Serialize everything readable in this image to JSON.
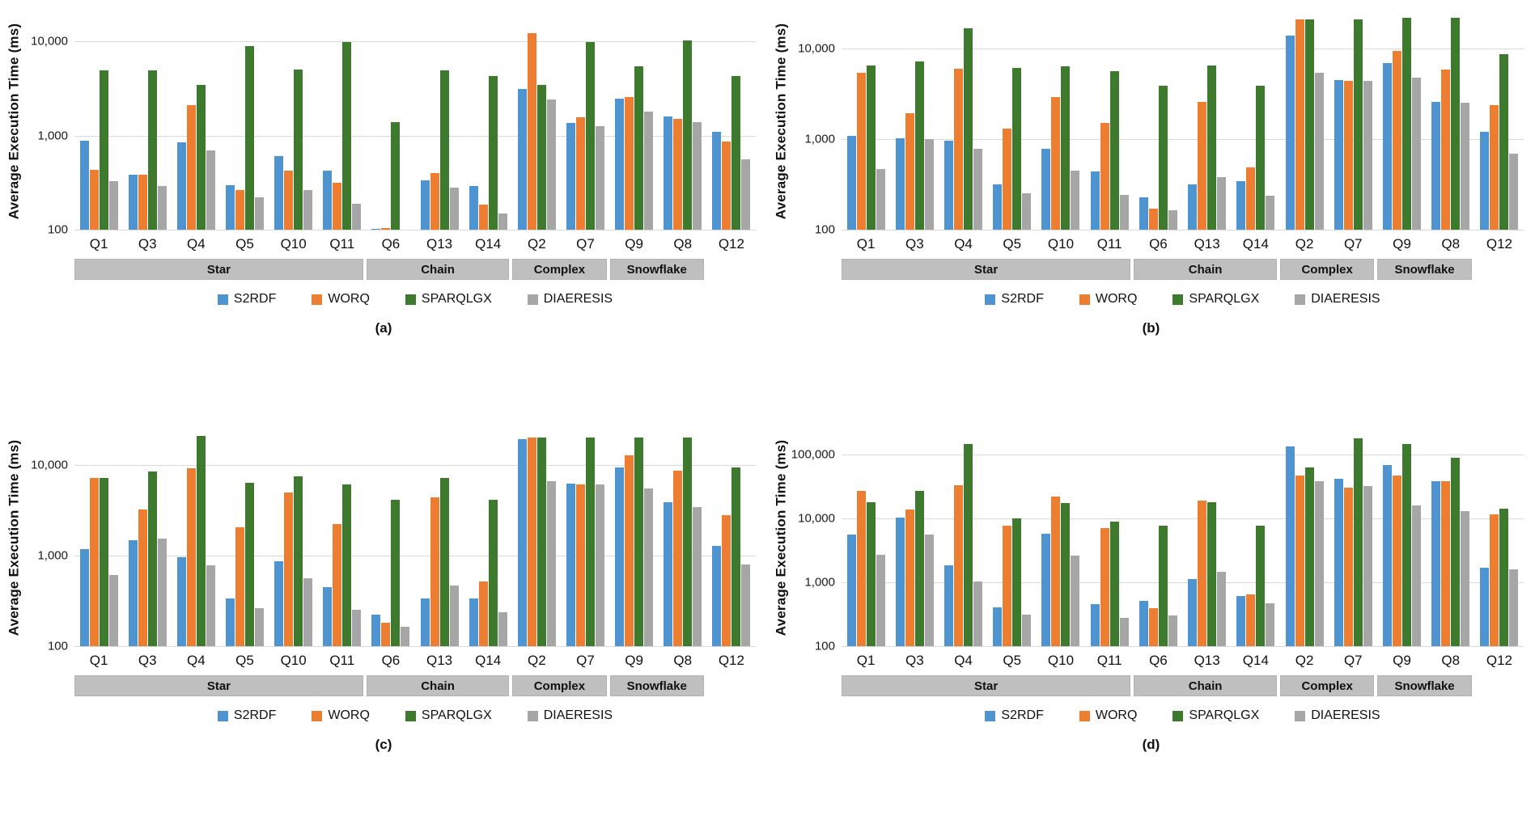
{
  "figure": {
    "panels": [
      "a",
      "b",
      "c",
      "d"
    ],
    "series_names": [
      "S2RDF",
      "WORQ",
      "SPARQLGX",
      "DIAERESIS"
    ],
    "series_colors": {
      "S2RDF": "#4e94d1",
      "WORQ": "#ed7d31",
      "SPARQLGX": "#3d7a2e",
      "DIAERESIS": "#a6a6a6"
    },
    "band_color": "#bfbfbf",
    "gridline_color": "#d9d9d9"
  },
  "legend": {
    "items": [
      {
        "label": "S2RDF",
        "swatch": "legend-swatch-blue"
      },
      {
        "label": "WORQ",
        "swatch": "legend-swatch-orange"
      },
      {
        "label": "SPARQLGX",
        "swatch": "legend-swatch-green"
      },
      {
        "label": "DIAERESIS",
        "swatch": "legend-swatch-gray"
      }
    ]
  },
  "bands": [
    {
      "label": "Star",
      "span": 6
    },
    {
      "label": "Chain",
      "span": 3
    },
    {
      "label": "Complex",
      "span": 2
    },
    {
      "label": "Snowflake",
      "span": 2
    }
  ],
  "captions": {
    "a": "(a)",
    "b": "(b)",
    "c": "(c)",
    "d": "(d)"
  },
  "chart_data": [
    {
      "panel": "a",
      "type": "bar",
      "title": "",
      "xlabel": "",
      "ylabel": "Average Execution Time (ms)",
      "yscale": "log",
      "ylim": [
        100,
        20000
      ],
      "yticks": [
        100,
        1000,
        10000
      ],
      "ytick_labels": [
        "100",
        "1,000",
        "10,000"
      ],
      "grid": true,
      "legend_position": "bottom",
      "categories": [
        "Q1",
        "Q3",
        "Q4",
        "Q5",
        "Q10",
        "Q11",
        "Q6",
        "Q13",
        "Q14",
        "Q2",
        "Q7",
        "Q9",
        "Q8",
        "Q12"
      ],
      "groups": [
        "Star",
        "Star",
        "Star",
        "Star",
        "Star",
        "Star",
        "Chain",
        "Chain",
        "Chain",
        "Complex",
        "Complex",
        "Snowflake",
        "Snowflake",
        "Snowflake"
      ],
      "series": [
        {
          "name": "S2RDF",
          "values": [
            880,
            385,
            840,
            295,
            600,
            425,
            103,
            335,
            290,
            3100,
            1350,
            2450,
            1600,
            1090
          ]
        },
        {
          "name": "WORQ",
          "values": [
            430,
            380,
            2100,
            265,
            425,
            315,
            105,
            400,
            185,
            12200,
            1550,
            2560,
            1500,
            870
          ]
        },
        {
          "name": "SPARQLGX",
          "values": [
            4900,
            4950,
            3450,
            8900,
            5000,
            9900,
            1400,
            4900,
            4250,
            3450,
            9900,
            5400,
            10300,
            4300
          ]
        },
        {
          "name": "DIAERESIS",
          "values": [
            330,
            290,
            690,
            220,
            265,
            190,
            null,
            280,
            150,
            2400,
            1250,
            1780,
            1400,
            560
          ]
        }
      ]
    },
    {
      "panel": "b",
      "type": "bar",
      "title": "",
      "xlabel": "",
      "ylabel": "Average Execution Time (ms)",
      "yscale": "log",
      "ylim": [
        100,
        25000
      ],
      "yticks": [
        100,
        1000,
        10000
      ],
      "ytick_labels": [
        "100",
        "1,000",
        "10,000"
      ],
      "grid": true,
      "legend_position": "bottom",
      "categories": [
        "Q1",
        "Q3",
        "Q4",
        "Q5",
        "Q10",
        "Q11",
        "Q6",
        "Q13",
        "Q14",
        "Q2",
        "Q7",
        "Q9",
        "Q8",
        "Q12"
      ],
      "groups": [
        "Star",
        "Star",
        "Star",
        "Star",
        "Star",
        "Star",
        "Chain",
        "Chain",
        "Chain",
        "Complex",
        "Complex",
        "Snowflake",
        "Snowflake",
        "Snowflake"
      ],
      "series": [
        {
          "name": "S2RDF",
          "values": [
            1100,
            1020,
            960,
            315,
            780,
            440,
            230,
            320,
            345,
            14000,
            4500,
            7000,
            2600,
            1200
          ]
        },
        {
          "name": "WORQ",
          "values": [
            5500,
            1950,
            6000,
            1320,
            2950,
            1530,
            170,
            2600,
            490,
            21000,
            4450,
            9400,
            5900,
            2400
          ]
        },
        {
          "name": "SPARQLGX",
          "values": [
            6500,
            7300,
            17000,
            6200,
            6400,
            5700,
            3950,
            6500,
            3900,
            21000,
            21000,
            22000,
            22000,
            8800
          ]
        },
        {
          "name": "DIAERESIS",
          "values": [
            470,
            1010,
            790,
            255,
            450,
            245,
            165,
            385,
            240,
            5500,
            4400,
            4800,
            2550,
            700
          ]
        }
      ]
    },
    {
      "panel": "c",
      "type": "bar",
      "title": "",
      "xlabel": "",
      "ylabel": "Average Execution Time (ms)",
      "yscale": "log",
      "ylim": [
        100,
        25000
      ],
      "yticks": [
        100,
        1000,
        10000
      ],
      "ytick_labels": [
        "100",
        "1,000",
        "10,000"
      ],
      "grid": true,
      "legend_position": "bottom",
      "categories": [
        "Q1",
        "Q3",
        "Q4",
        "Q5",
        "Q10",
        "Q11",
        "Q6",
        "Q13",
        "Q14",
        "Q2",
        "Q7",
        "Q9",
        "Q8",
        "Q12"
      ],
      "groups": [
        "Star",
        "Star",
        "Star",
        "Star",
        "Star",
        "Star",
        "Chain",
        "Chain",
        "Chain",
        "Complex",
        "Complex",
        "Snowflake",
        "Snowflake",
        "Snowflake"
      ],
      "series": [
        {
          "name": "S2RDF",
          "values": [
            1180,
            1500,
            960,
            340,
            870,
            450,
            225,
            340,
            335,
            19500,
            6300,
            9500,
            3900,
            1300
          ]
        },
        {
          "name": "WORQ",
          "values": [
            7200,
            3250,
            9300,
            2050,
            5000,
            2250,
            180,
            4400,
            520,
            20500,
            6200,
            13000,
            8800,
            2800
          ]
        },
        {
          "name": "SPARQLGX",
          "values": [
            7300,
            8500,
            21000,
            6400,
            7600,
            6200,
            4150,
            7200,
            4200,
            20500,
            20500,
            20500,
            20500,
            9400
          ]
        },
        {
          "name": "DIAERESIS",
          "values": [
            610,
            1540,
            780,
            265,
            560,
            255,
            165,
            465,
            240,
            6700,
            6200,
            5600,
            3450,
            800
          ]
        }
      ]
    },
    {
      "panel": "d",
      "type": "bar",
      "title": "",
      "xlabel": "",
      "ylabel": "Average Execution Time (ms)",
      "yscale": "log",
      "ylim": [
        100,
        250000
      ],
      "yticks": [
        100,
        1000,
        10000,
        100000
      ],
      "ytick_labels": [
        "100",
        "1,000",
        "10,000",
        "100,000"
      ],
      "grid": true,
      "legend_position": "bottom",
      "categories": [
        "Q1",
        "Q3",
        "Q4",
        "Q5",
        "Q10",
        "Q11",
        "Q6",
        "Q13",
        "Q14",
        "Q2",
        "Q7",
        "Q9",
        "Q8",
        "Q12"
      ],
      "groups": [
        "Star",
        "Star",
        "Star",
        "Star",
        "Star",
        "Star",
        "Chain",
        "Chain",
        "Chain",
        "Complex",
        "Complex",
        "Snowflake",
        "Snowflake",
        "Snowflake"
      ],
      "series": [
        {
          "name": "S2RDF",
          "values": [
            5600,
            10300,
            1850,
            410,
            5800,
            460,
            510,
            1120,
            620,
            135000,
            42000,
            70000,
            39000,
            1720
          ]
        },
        {
          "name": "WORQ",
          "values": [
            27000,
            14000,
            33000,
            7800,
            22000,
            7000,
            400,
            19000,
            640,
            48000,
            31000,
            48000,
            39000,
            11500
          ]
        },
        {
          "name": "SPARQLGX",
          "values": [
            18000,
            27000,
            150000,
            10200,
            17500,
            9000,
            7700,
            18000,
            7700,
            63000,
            180000,
            148000,
            90000,
            14500
          ]
        },
        {
          "name": "DIAERESIS",
          "values": [
            2700,
            5600,
            1040,
            310,
            2600,
            280,
            305,
            1450,
            470,
            39000,
            32000,
            16000,
            13000,
            1620
          ]
        }
      ]
    }
  ]
}
